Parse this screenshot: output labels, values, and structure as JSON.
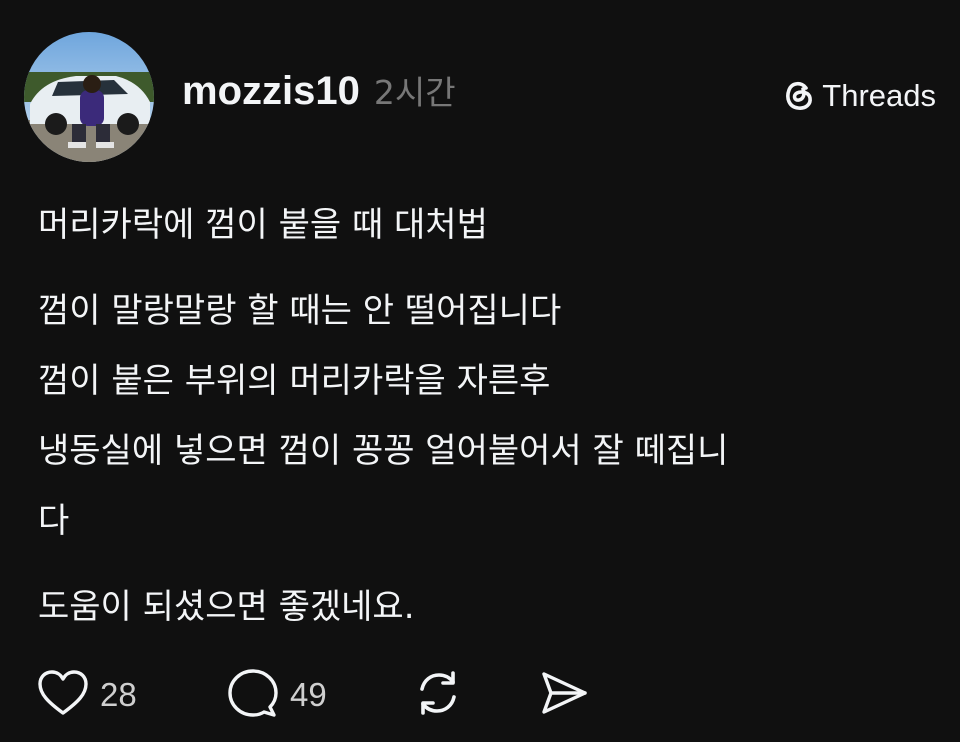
{
  "post": {
    "username": "mozzis10",
    "time": "2시간",
    "brand": "Threads",
    "title": "머리카락에 껌이 붙을 때 대처법",
    "body_lines": [
      "껌이 말랑말랑 할 때는 안 떨어집니다",
      "껌이 붙은 부위의 머리카락을 자른후",
      "냉동실에 넣으면 껌이 꽁꽁 얼어붙어서 잘 떼집니",
      "다"
    ],
    "closing": "도움이 되셨으면 좋겠네요."
  },
  "actions": {
    "like_count": "28",
    "comment_count": "49"
  },
  "icons": {
    "brand": "threads-logo-icon",
    "like": "heart-icon",
    "comment": "comment-bubble-icon",
    "repost": "repost-icon",
    "share": "send-icon"
  },
  "colors": {
    "background": "#101010",
    "text": "#f3f5f7",
    "muted": "#777777"
  }
}
